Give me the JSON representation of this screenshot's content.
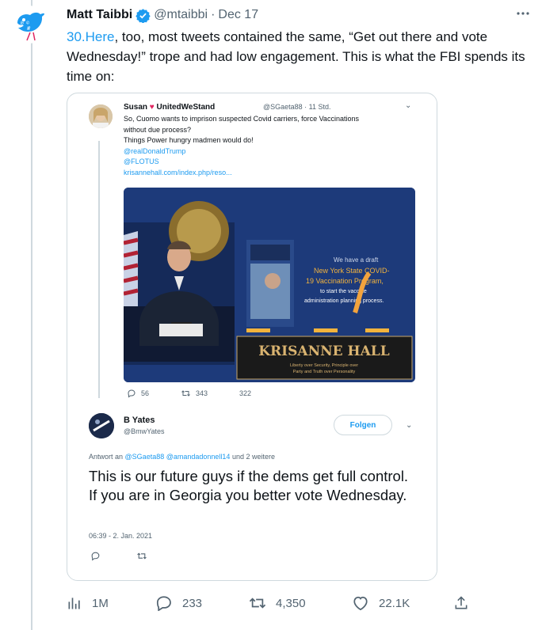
{
  "tweet": {
    "author_name": "Matt Taibbi",
    "handle": "@mtaibbi",
    "separator": "·",
    "timestamp": "Dec 17",
    "text_link": "30.Here",
    "text_body": ", too, most tweets contained the same, “Get out there and vote Wednesday!” trope and had low engagement. This is what the FBI spends its time on:"
  },
  "embedded": {
    "original": {
      "name": "Susan",
      "name_suffix": "UnitedWeStand",
      "handle_time": "@SGaeta88 · 11 Std.",
      "line1": "So, Cuomo wants to imprison suspected Covid carriers, force Vaccinations",
      "line2": "without due process?",
      "line3": "Things Power hungry madmen would do!",
      "mention1": "@realDonaldTrump",
      "mention2": "@FLOTUS",
      "link": "krisannehall.com/index.php/reso...",
      "image_draft_line1": "We have a draft",
      "image_draft_line2": "New York State COVID-",
      "image_draft_line3": "19 Vaccination Program,",
      "image_draft_line4": "to start the vaccine",
      "image_draft_line5": "administration planning process.",
      "image_brand": "KRISANNE HALL",
      "image_tagline1": "Liberty over Security, Principle over",
      "image_tagline2": "Party and Truth over Personality",
      "replies": "56",
      "retweets": "343",
      "likes": "322"
    },
    "reply": {
      "name": "B Yates",
      "handle": "@BmwYates",
      "follow_label": "Folgen",
      "reply_prefix": "Antwort an",
      "reply_users": "@SGaeta88 @amandadonnell14",
      "reply_suffix": "und 2 weitere",
      "text": "This is our future guys if the dems get full control. If you are in Georgia you better vote Wednesday.",
      "time": "06:39 - 2. Jan. 2021"
    }
  },
  "actions": {
    "views": "1M",
    "replies": "233",
    "retweets": "4,350",
    "likes": "22.1K"
  },
  "colors": {
    "accent": "#1d9bf0",
    "text": "#0f1419",
    "muted": "#536471",
    "border": "#cfd9de"
  },
  "icons": [
    "twitter-bird-avatar-icon",
    "verified-badge-icon",
    "more-icon",
    "views-icon",
    "reply-icon",
    "retweet-icon",
    "like-icon",
    "share-icon"
  ]
}
